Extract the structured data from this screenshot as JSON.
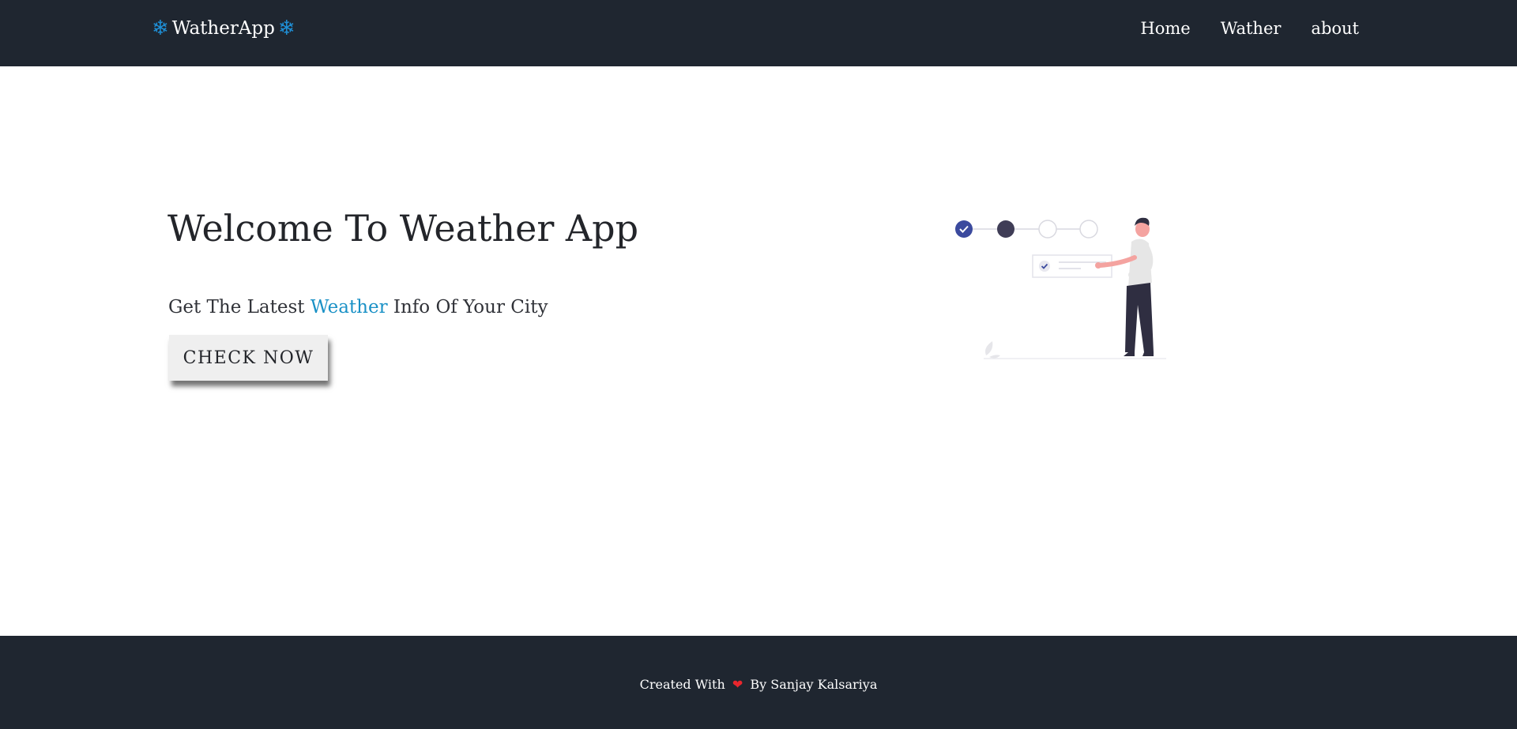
{
  "navbar": {
    "brand": "WatherApp",
    "brand_icon": "snowflake-icon",
    "brand_icon_color": "#1f8fd6",
    "links": [
      {
        "label": "Home"
      },
      {
        "label": "Wather"
      },
      {
        "label": "about"
      }
    ],
    "background": "#1f2630"
  },
  "hero": {
    "title": "Welcome To Weather App",
    "subtitle_prefix": "Get The Latest",
    "subtitle_highlight": "Weather",
    "subtitle_suffix": "Info Of Your City",
    "highlight_color": "#1a91c6",
    "button_label": "CHECK NOW"
  },
  "illustration": {
    "icon": "person-progress-steps-illustration",
    "colors": {
      "primary": "#3b4a9e",
      "dark": "#3f3d56",
      "skin": "#f4a3a0"
    }
  },
  "footer": {
    "text_prefix": "Created With",
    "heart_icon": "heart-icon",
    "heart_color": "#e8262d",
    "text_suffix": "By Sanjay Kalsariya"
  }
}
